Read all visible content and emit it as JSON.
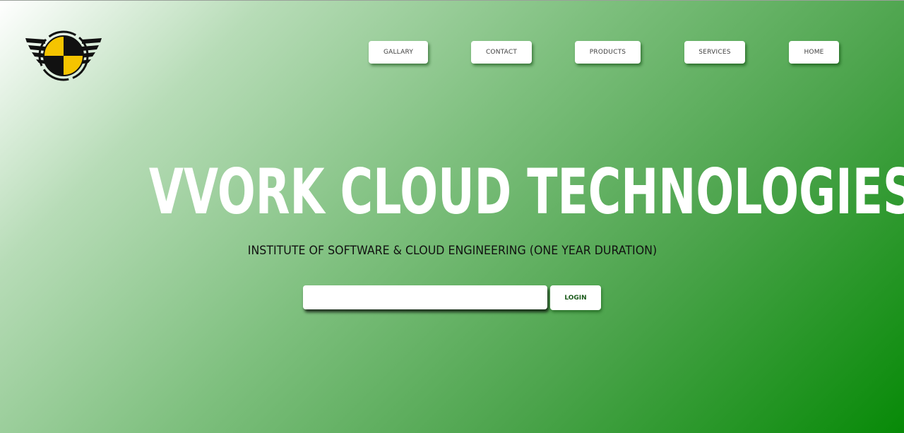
{
  "header": {
    "logo_icon": "winged-checkered-badge-icon",
    "nav": [
      {
        "label": "GALLARY"
      },
      {
        "label": "CONTACT"
      },
      {
        "label": "PRODUCTS"
      },
      {
        "label": "SERVICES"
      },
      {
        "label": "HOME"
      }
    ]
  },
  "hero": {
    "title": "VVORK CLOUD TECHNOLOGIES",
    "subtitle": "INSTITUTE OF SOFTWARE & CLOUD ENGINEERING (ONE YEAR DURATION)"
  },
  "login": {
    "input_value": "",
    "button_label": "LOGIN"
  },
  "colors": {
    "gradient_start": "#ffffff",
    "gradient_end": "#078a07",
    "logo_yellow": "#f5c400",
    "logo_black": "#111111"
  }
}
